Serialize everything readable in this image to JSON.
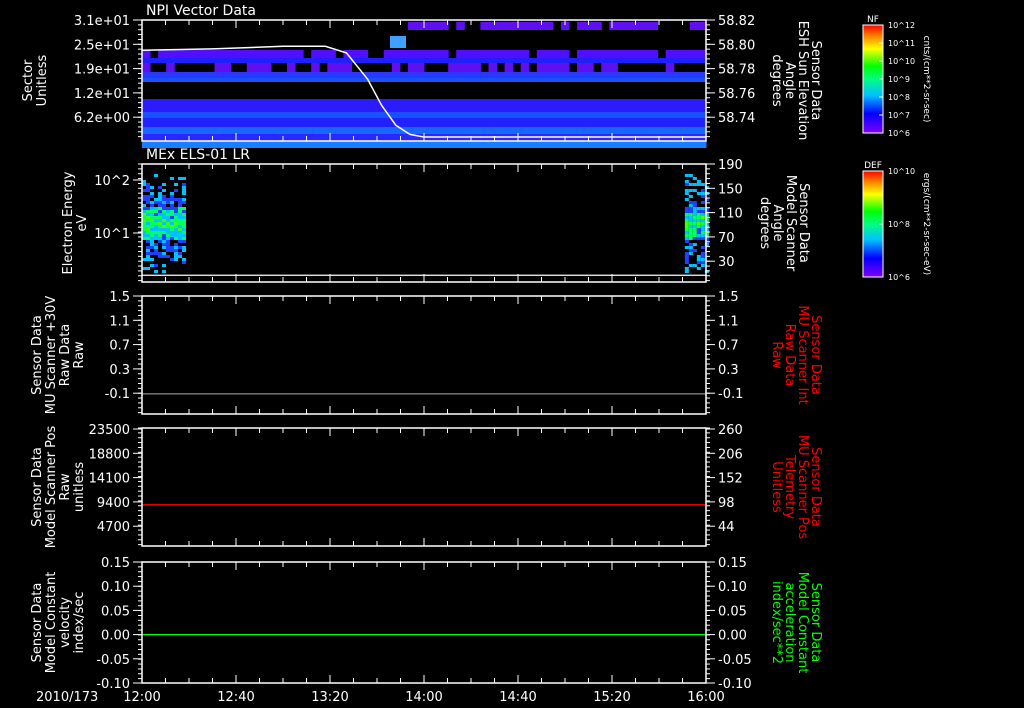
{
  "date_label": "2010/173",
  "colors": {
    "background": "#000000",
    "axis": "#ffffff",
    "red": "#ff0000",
    "green": "#00ff00",
    "gray": "#808080"
  },
  "chart_data": [
    {
      "type": "heatmap",
      "title": "NPI Vector Data",
      "ylabel_left": [
        "Sector",
        "Unitless"
      ],
      "ylabel_right": [
        "Sensor Data",
        "ESH Sun Elevation",
        "Angle",
        "degrees"
      ],
      "yticks_left": [
        "3.1e+01",
        "2.5e+01",
        "1.9e+01",
        "1.2e+01",
        "6.2e+00"
      ],
      "yticks_right": [
        "58.82",
        "58.80",
        "58.78",
        "58.76",
        "58.74"
      ],
      "ylim_right": [
        58.728,
        58.82
      ],
      "line_series": {
        "name": "ESH Sun Elevation Angle",
        "x_hours": [
          12.0,
          12.5,
          13.0,
          13.3,
          13.45,
          13.6,
          13.7,
          13.8,
          13.9,
          14.0,
          16.0
        ],
        "y": [
          58.797,
          58.798,
          58.8,
          58.8,
          58.795,
          58.775,
          58.755,
          58.74,
          58.733,
          58.731,
          58.731
        ],
        "color": "#ffffff"
      },
      "colorbar": {
        "label": "NF",
        "ticks": [
          "10^12",
          "10^11",
          "10^10",
          "10^9",
          "10^8",
          "10^7",
          "10^6"
        ],
        "units": "cnts/(cm**2-sr-sec)"
      }
    },
    {
      "type": "heatmap",
      "title": "MEx ELS-01 LR",
      "ylabel_left": [
        "Electron Energy",
        "eV"
      ],
      "ylabel_right": [
        "Sensor Data",
        "Model Scanner",
        "Angle",
        "degrees"
      ],
      "yticks_left": [
        "10^2",
        "10^1"
      ],
      "yticks_right": [
        "190",
        "150",
        "110",
        "70",
        "30"
      ],
      "ylim_right": [
        -3,
        190
      ],
      "data_intervals_hours": [
        [
          12.0,
          12.3
        ],
        [
          15.85,
          16.0
        ]
      ],
      "line_series": {
        "name": "Model Scanner Angle",
        "value": 8,
        "color": "#ffffff"
      },
      "colorbar": {
        "label": "DEF",
        "ticks": [
          "10^10",
          "10^8",
          "10^6"
        ],
        "units": "ergs/(cm**2-sr-sec-eV)"
      }
    },
    {
      "type": "line",
      "ylabel_left": [
        "Sensor Data",
        "MU Scanner +30V",
        "Raw Data",
        "Raw"
      ],
      "ylabel_right": [
        "Sensor Data",
        "MU Scanner Int",
        "Raw Data",
        "Raw"
      ],
      "yticks_left": [
        "1.5",
        "1.1",
        "0.7",
        "0.3",
        "-0.1"
      ],
      "yticks_right": [
        "1.5",
        "1.1",
        "0.7",
        "0.3",
        "-0.1"
      ],
      "ylim": [
        -0.31,
        1.5
      ],
      "series": [
        {
          "name": "MU Scanner Int",
          "value": 0.0,
          "color": "#808080"
        }
      ],
      "right_label_color": "#ff0000"
    },
    {
      "type": "line",
      "ylabel_left": [
        "Sensor Data",
        "Model Scanner Pos",
        "Raw",
        "unitless"
      ],
      "ylabel_right": [
        "Sensor Data",
        "MU Scanner Pos",
        "Telemetry",
        "Unitless"
      ],
      "yticks_left": [
        "23500",
        "18800",
        "14100",
        "9400",
        "4700"
      ],
      "yticks_right": [
        "260",
        "206",
        "152",
        "98",
        "44"
      ],
      "ylim": [
        0,
        23500
      ],
      "series": [
        {
          "name": "MU Scanner Pos",
          "value": 8200,
          "color": "#ff0000"
        }
      ],
      "right_label_color": "#ff0000"
    },
    {
      "type": "line",
      "ylabel_left": [
        "Sensor Data",
        "Model Constant",
        "velocity",
        "index/sec"
      ],
      "ylabel_right": [
        "Sensor Data",
        "Model Constant",
        "acceleration",
        "index/sec**2"
      ],
      "yticks_left": [
        "0.15",
        "0.10",
        "0.05",
        "0.00",
        "-0.05",
        "-0.10"
      ],
      "yticks_right": [
        "0.15",
        "0.10",
        "0.05",
        "0.00",
        "-0.05",
        "-0.10"
      ],
      "ylim": [
        -0.1,
        0.15
      ],
      "series": [
        {
          "name": "Model Constant acceleration",
          "value": 0.0,
          "color": "#00ff00"
        }
      ],
      "right_label_color": "#00ff00"
    }
  ],
  "x_axis": {
    "ticks": [
      "12:00",
      "12:40",
      "13:20",
      "14:00",
      "14:40",
      "15:20",
      "16:00"
    ],
    "xlim_hours": [
      12.0,
      16.0
    ]
  }
}
